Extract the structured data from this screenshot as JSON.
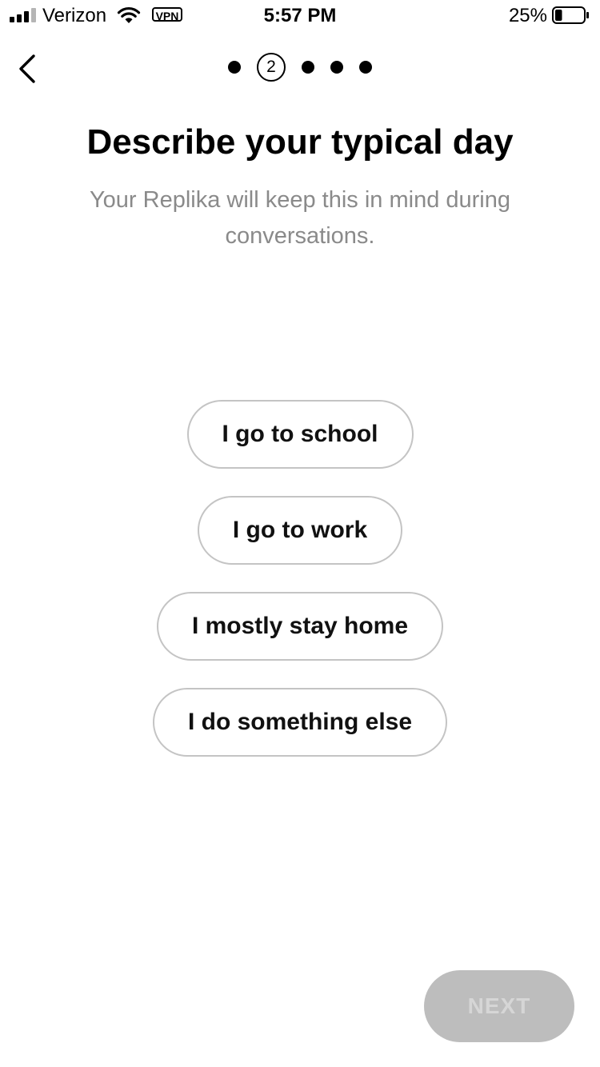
{
  "status_bar": {
    "carrier": "Verizon",
    "vpn": "VPN",
    "time": "5:57 PM",
    "battery_percent": "25%",
    "battery_level": 0.25
  },
  "nav": {
    "back_icon": "chevron-left-icon",
    "steps_total": 5,
    "current_step": "2"
  },
  "header": {
    "title": "Describe your typical day",
    "subtitle": "Your Replika will keep this in mind during conversations."
  },
  "options": [
    {
      "label": "I go to school"
    },
    {
      "label": "I go to work"
    },
    {
      "label": "I mostly stay home"
    },
    {
      "label": "I do something else"
    }
  ],
  "footer": {
    "next_label": "NEXT",
    "next_enabled": false
  },
  "colors": {
    "option_border": "#c4c4c4",
    "subtitle_text": "#8a8a8a",
    "next_disabled_bg": "#bdbdbd",
    "next_disabled_text": "#d6d6d6"
  }
}
